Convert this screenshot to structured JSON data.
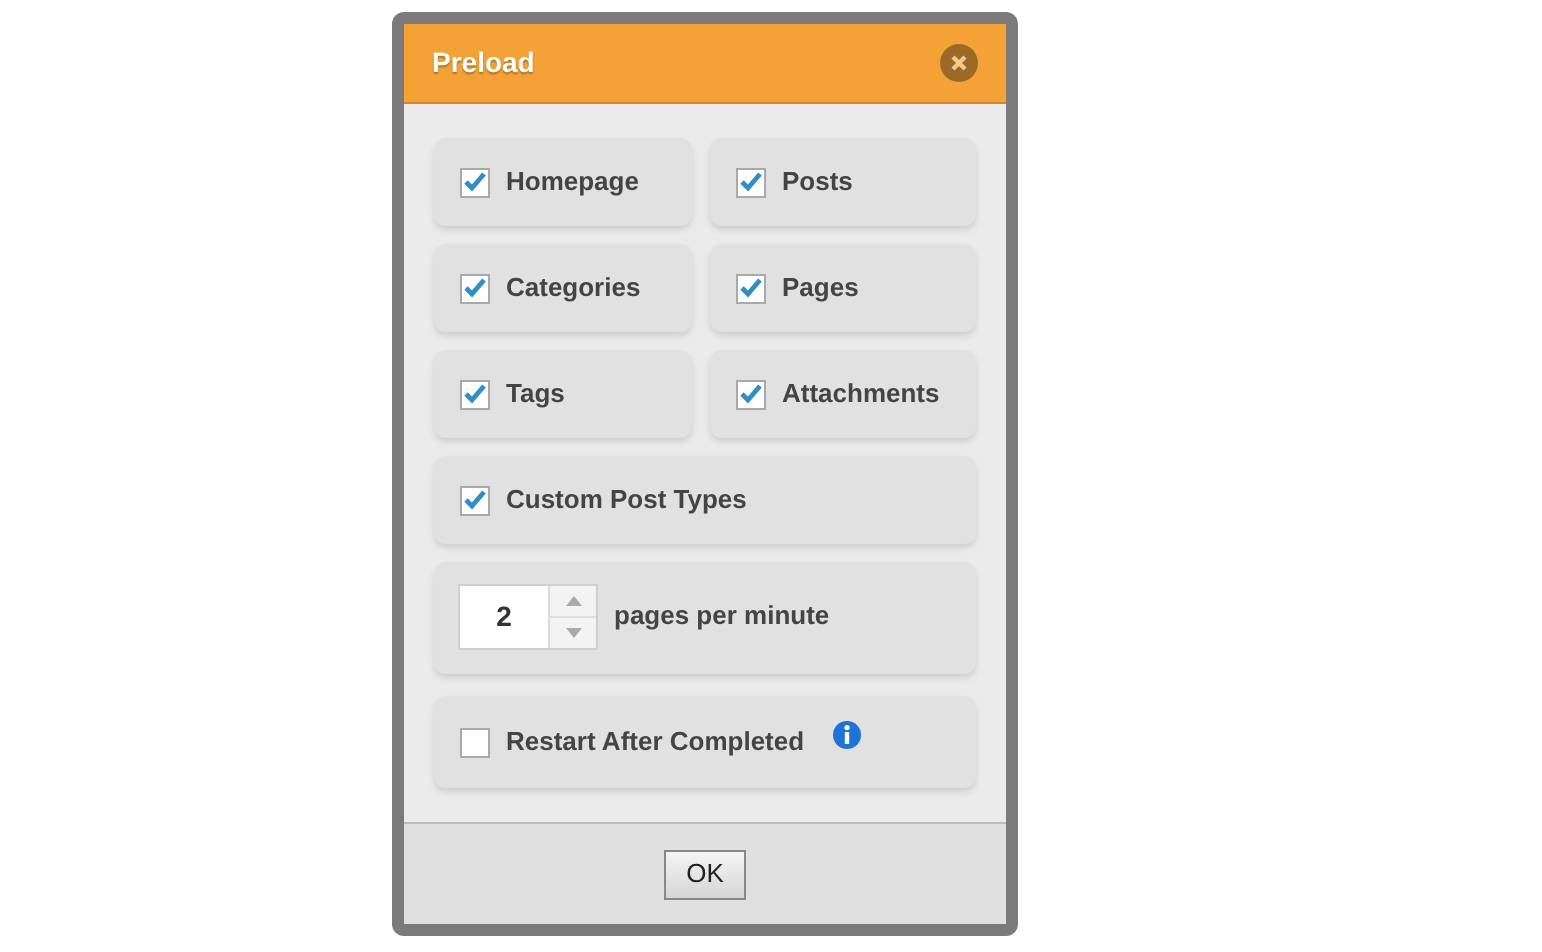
{
  "dialog": {
    "title": "Preload"
  },
  "post_types": [
    {
      "label": "Homepage",
      "checked": true
    },
    {
      "label": "Posts",
      "checked": true
    },
    {
      "label": "Categories",
      "checked": true
    },
    {
      "label": "Pages",
      "checked": true
    },
    {
      "label": "Tags",
      "checked": true
    },
    {
      "label": "Attachments",
      "checked": true
    }
  ],
  "custom_post_types": {
    "label": "Custom Post Types",
    "checked": true
  },
  "rate": {
    "value": "2",
    "label": "pages per minute"
  },
  "restart": {
    "label": "Restart After Completed",
    "checked": false
  },
  "buttons": [
    "OK"
  ]
}
